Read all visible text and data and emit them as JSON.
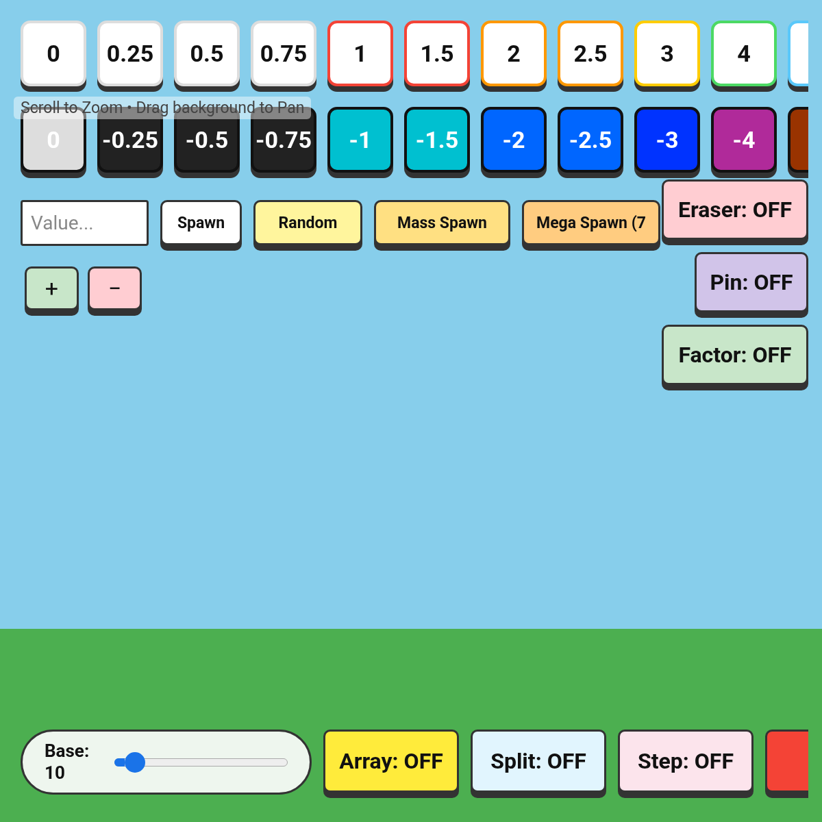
{
  "positive_blocks": [
    {
      "label": "0",
      "color": "#dddddd"
    },
    {
      "label": "0.25",
      "color": "#dddddd"
    },
    {
      "label": "0.5",
      "color": "#dddddd"
    },
    {
      "label": "0.75",
      "color": "#dddddd"
    },
    {
      "label": "1",
      "color": "#f44336"
    },
    {
      "label": "1.5",
      "color": "#f44336"
    },
    {
      "label": "2",
      "color": "#ff9800"
    },
    {
      "label": "2.5",
      "color": "#ff9800"
    },
    {
      "label": "3",
      "color": "#ffcc00"
    },
    {
      "label": "4",
      "color": "#4cd964"
    },
    {
      "color": "#5ac8fa"
    }
  ],
  "negative_blocks": [
    {
      "label": "0",
      "color": "#dddddd"
    },
    {
      "label": "-0.25",
      "color": "#222222"
    },
    {
      "label": "-0.5",
      "color": "#222222"
    },
    {
      "label": "-0.75",
      "color": "#222222"
    },
    {
      "label": "-1",
      "color": "#00c0d0"
    },
    {
      "label": "-1.5",
      "color": "#00c0d0"
    },
    {
      "label": "-2",
      "color": "#0066ff"
    },
    {
      "label": "-2.5",
      "color": "#0066ff"
    },
    {
      "label": "-3",
      "color": "#0033ff"
    },
    {
      "label": "-4",
      "color": "#b02a9a"
    },
    {
      "color": "#993300"
    }
  ],
  "hint": "Scroll to Zoom • Drag background to Pan",
  "value_field": {
    "placeholder": "Value..."
  },
  "spawn_buttons": [
    {
      "label": "Spawn",
      "color": "#ffffff"
    },
    {
      "label": "Random",
      "color": "#fff59d"
    },
    {
      "label": "Mass Spawn",
      "color": "#ffe082"
    },
    {
      "label": "Mega Spawn (7",
      "color": "#ffcc80"
    }
  ],
  "zoom_buttons": [
    {
      "label": "+",
      "color": "#c8e6c9"
    },
    {
      "label": "−",
      "color": "#ffcdd2"
    }
  ],
  "toggles": [
    {
      "label": "Eraser: OFF",
      "color": "#ffcdd2"
    },
    {
      "label": "Pin: OFF",
      "color": "#d1c4e9"
    },
    {
      "label": "Factor: OFF",
      "color": "#c8e6c9"
    }
  ],
  "base": {
    "label": "Base: 10",
    "level": 0.12
  },
  "mode_buttons": [
    {
      "label": "Array: OFF",
      "color": "#ffeb3b"
    },
    {
      "label": "Split: OFF",
      "color": "#e1f5fe"
    },
    {
      "label": "Step: OFF",
      "color": "#fce4ec"
    },
    {
      "color": "#f44336"
    }
  ]
}
